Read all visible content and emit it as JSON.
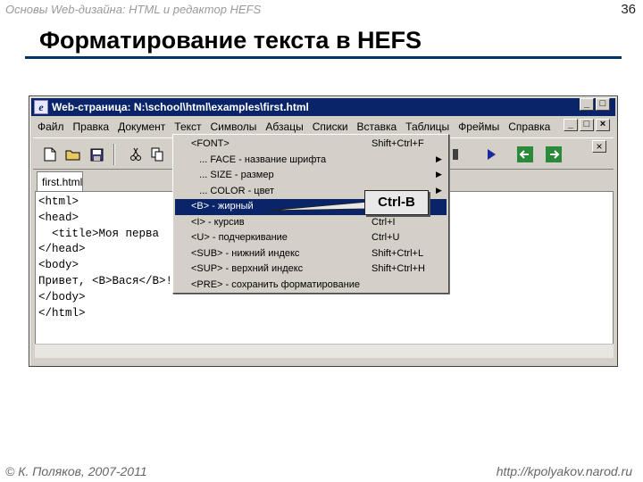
{
  "slide": {
    "course": "Основы Web-дизайна: HTML и редактор HEFS",
    "number": "36",
    "title": "Форматирование текста в HEFS",
    "footer_left": "© К. Поляков, 2007-2011",
    "footer_right": "http://kpolyakov.narod.ru"
  },
  "window": {
    "title": "Web-страница: N:\\school\\html\\examples\\first.html",
    "menu": [
      "Файл",
      "Правка",
      "Документ",
      "Текст",
      "Символы",
      "Абзацы",
      "Списки",
      "Вставка",
      "Таблицы",
      "Фреймы",
      "Справка"
    ],
    "tab": "first.html",
    "code_lines": [
      "<html>",
      "<head>",
      "  <title>Моя перва",
      "</head>",
      "<body>",
      "Привет, <B>Вася</B>!",
      "</body>",
      "</html>"
    ]
  },
  "dropdown": {
    "items": [
      {
        "label": "<FONT>",
        "shortcut": "Shift+Ctrl+F",
        "submenu": false
      },
      {
        "label": "   ... FACE - название шрифта",
        "shortcut": "",
        "submenu": true
      },
      {
        "label": "   ... SIZE - размер",
        "shortcut": "",
        "submenu": true
      },
      {
        "label": "   ... COLOR - цвет",
        "shortcut": "",
        "submenu": true
      },
      {
        "label": "<B> - жирный",
        "shortcut": "Ctrl+B",
        "submenu": false,
        "selected": true
      },
      {
        "label": "<I> - курсив",
        "shortcut": "Ctrl+I",
        "submenu": false
      },
      {
        "label": "<U> - подчеркивание",
        "shortcut": "Ctrl+U",
        "submenu": false
      },
      {
        "label": "<SUB> - нижний индекс",
        "shortcut": "Shift+Ctrl+L",
        "submenu": false
      },
      {
        "label": "<SUP> - верхний индекс",
        "shortcut": "Shift+Ctrl+H",
        "submenu": false
      },
      {
        "label": "<PRE> - сохранить форматирование",
        "shortcut": "",
        "submenu": false
      }
    ]
  },
  "callout": "Ctrl-B",
  "colors": {
    "titlebar": "#0a246a",
    "rule": "#003366",
    "selected": "#0a246a"
  }
}
